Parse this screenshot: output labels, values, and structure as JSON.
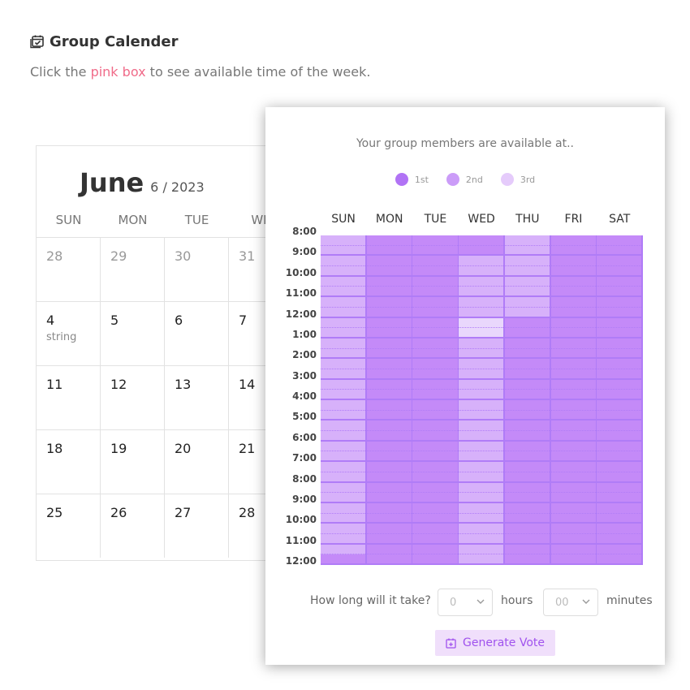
{
  "page": {
    "title": "Group Calender",
    "subtitle_before": "Click the ",
    "subtitle_link": "pink box",
    "subtitle_after": " to see available time of the week."
  },
  "calendar": {
    "month": "June",
    "date_label": "6 / 2023",
    "day_headers": [
      "SUN",
      "MON",
      "TUE",
      "WE"
    ],
    "weeks": [
      [
        {
          "d": "28",
          "muted": true
        },
        {
          "d": "29",
          "muted": true
        },
        {
          "d": "30",
          "muted": true
        },
        {
          "d": "31",
          "muted": true
        }
      ],
      [
        {
          "d": "4",
          "note": "string"
        },
        {
          "d": "5"
        },
        {
          "d": "6"
        },
        {
          "d": "7"
        }
      ],
      [
        {
          "d": "11"
        },
        {
          "d": "12"
        },
        {
          "d": "13"
        },
        {
          "d": "14"
        }
      ],
      [
        {
          "d": "18"
        },
        {
          "d": "19"
        },
        {
          "d": "20"
        },
        {
          "d": "21"
        }
      ],
      [
        {
          "d": "25"
        },
        {
          "d": "26"
        },
        {
          "d": "27"
        },
        {
          "d": "28"
        }
      ]
    ]
  },
  "modal": {
    "title": "Your group members are available at..",
    "legend": [
      {
        "label": "1st",
        "color": "#b173f5"
      },
      {
        "label": "2nd",
        "color": "#cb9cf8"
      },
      {
        "label": "3rd",
        "color": "#e5cbfb"
      }
    ],
    "days": [
      "SUN",
      "MON",
      "TUE",
      "WED",
      "THU",
      "FRI",
      "SAT"
    ],
    "times": [
      "8:00",
      "9:00",
      "10:00",
      "11:00",
      "12:00",
      "1:00",
      "2:00",
      "3:00",
      "4:00",
      "5:00",
      "6:00",
      "7:00",
      "8:00",
      "9:00",
      "10:00",
      "11:00",
      "12:00"
    ],
    "colors": {
      "level1": "#c48af8",
      "level2": "#d7b1fa",
      "level3": "#e9d7fc",
      "line": "#b07cf7"
    },
    "availability": {
      "SUN": [
        2,
        2,
        2,
        2,
        2,
        2,
        2,
        2,
        2,
        2,
        2,
        2,
        2,
        2,
        2,
        2,
        2,
        2,
        2,
        2,
        2,
        2,
        2,
        2,
        2,
        2,
        2,
        2,
        2,
        2,
        2,
        1
      ],
      "MON": [
        1,
        1,
        1,
        1,
        1,
        1,
        1,
        1,
        1,
        1,
        1,
        1,
        1,
        1,
        1,
        1,
        1,
        1,
        1,
        1,
        1,
        1,
        1,
        1,
        1,
        1,
        1,
        1,
        1,
        1,
        1,
        1
      ],
      "TUE": [
        1,
        1,
        1,
        1,
        1,
        1,
        1,
        1,
        1,
        1,
        1,
        1,
        1,
        1,
        1,
        1,
        1,
        1,
        1,
        1,
        1,
        1,
        1,
        1,
        1,
        1,
        1,
        1,
        1,
        1,
        1,
        1
      ],
      "WED": [
        1,
        1,
        2,
        2,
        2,
        2,
        2,
        2,
        3,
        3,
        2,
        2,
        2,
        2,
        2,
        2,
        2,
        2,
        2,
        2,
        2,
        2,
        2,
        2,
        2,
        2,
        2,
        2,
        2,
        2,
        2,
        2
      ],
      "THU": [
        2,
        2,
        2,
        2,
        2,
        2,
        2,
        2,
        1,
        1,
        1,
        1,
        1,
        1,
        1,
        1,
        1,
        1,
        1,
        1,
        1,
        1,
        1,
        1,
        1,
        1,
        1,
        1,
        1,
        1,
        1,
        1
      ],
      "FRI": [
        1,
        1,
        1,
        1,
        1,
        1,
        1,
        1,
        1,
        1,
        1,
        1,
        1,
        1,
        1,
        1,
        1,
        1,
        1,
        1,
        1,
        1,
        1,
        1,
        1,
        1,
        1,
        1,
        1,
        1,
        1,
        1
      ],
      "SAT": [
        1,
        1,
        1,
        1,
        1,
        1,
        1,
        1,
        1,
        1,
        1,
        1,
        1,
        1,
        1,
        1,
        1,
        1,
        1,
        1,
        1,
        1,
        1,
        1,
        1,
        1,
        1,
        1,
        1,
        1,
        1,
        1
      ]
    },
    "duration_label": "How long will it take?",
    "hours_value": "0",
    "hours_unit": "hours",
    "minutes_value": "00",
    "minutes_unit": "minutes",
    "generate_label": "Generate Vote"
  }
}
